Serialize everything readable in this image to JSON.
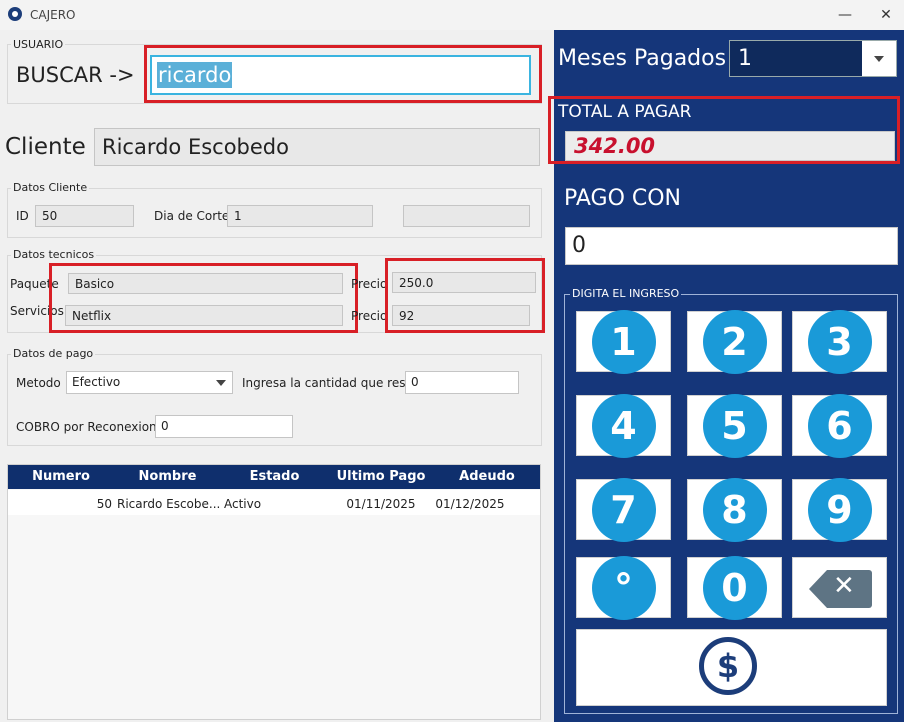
{
  "window": {
    "title": "CAJERO",
    "minimize_glyph": "—",
    "close_glyph": "✕"
  },
  "usuario": {
    "legend": "USUARIO",
    "buscar_label": "BUSCAR ->",
    "search_value": "ricardo"
  },
  "cliente": {
    "label": "Cliente",
    "value": "Ricardo Escobedo"
  },
  "datos_cliente": {
    "legend": "Datos Cliente",
    "id_label": "ID",
    "id_value": "50",
    "dia_label": "Dia de Corte",
    "dia_value": "1",
    "extra_value": ""
  },
  "datos_tecnicos": {
    "legend": "Datos tecnicos",
    "paquete_label": "Paquete",
    "paquete_value": "Basico",
    "servicios_label": "Servicios",
    "servicios_value": "Netflix",
    "precio1_label": "Precio",
    "precio1_value": "250.0",
    "precio2_label": "Precio",
    "precio2_value": "92"
  },
  "datos_pago": {
    "legend": "Datos de pago",
    "metodo_label": "Metodo",
    "metodo_value": "Efectivo",
    "restas_label": "Ingresa la cantidad que restas",
    "restas_value": "0",
    "cobro_label": "COBRO por Reconexion",
    "cobro_value": "0"
  },
  "table": {
    "headers": [
      "Numero",
      "Nombre",
      "Estado",
      "Ultimo Pago",
      "Adeudo"
    ],
    "rows": [
      [
        "50",
        "Ricardo Escobe...",
        "Activo",
        "01/11/2025",
        "01/12/2025"
      ]
    ]
  },
  "payment": {
    "meses_label": "Meses Pagados",
    "meses_value": "1",
    "total_label": "TOTAL A PAGAR",
    "total_value": "342.00",
    "pago_label": "PAGO CON",
    "pago_value": "0",
    "keypad_legend": "DIGITA EL INGRESO",
    "keys": [
      "1",
      "2",
      "3",
      "4",
      "5",
      "6",
      "7",
      "8",
      "9",
      "°",
      "0"
    ],
    "backspace_glyph": "✕",
    "pay_glyph": "$"
  },
  "colors": {
    "panel": "#15367a",
    "accent_red": "#d81f26",
    "key_blue": "#1a9ad8",
    "total_text": "#c8102e"
  }
}
